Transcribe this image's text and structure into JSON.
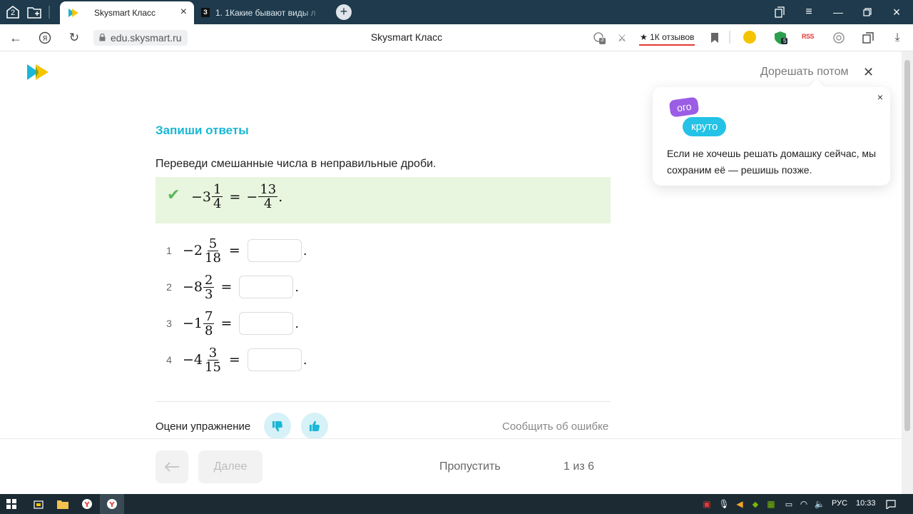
{
  "browser": {
    "tab_counter": "2",
    "active_tab_title": "Skysmart Класс",
    "inactive_tab_title": "1. 1Какие бывают виды л",
    "inactive_tab_favicon": "З",
    "url": "edu.skysmart.ru",
    "page_title": "Skysmart Класс",
    "reviews": "★ 1К отзывов",
    "ext_badge_count": "3",
    "shield_count": "5",
    "rss_label": "RSS"
  },
  "header": {
    "later_label": "Дорешать потом"
  },
  "tooltip": {
    "sticker_1": "ого",
    "sticker_2": "круто",
    "text": "Если не хочешь решать домашку сейчас, мы сохраним её — решишь позже."
  },
  "exercise": {
    "heading": "Запиши ответы",
    "instruction": "Переведи смешанные числа в неправильные дроби.",
    "example": {
      "lhs_sign": "−",
      "lhs_whole": "3",
      "lhs_num": "1",
      "lhs_den": "4",
      "equals": "=",
      "rhs_sign": "−",
      "rhs_num": "13",
      "rhs_den": "4",
      "end": "."
    },
    "tasks": [
      {
        "index": "1",
        "sign": "−",
        "whole": "2",
        "num": "5",
        "den": "18",
        "equals": "=",
        "answer": "",
        "end": "."
      },
      {
        "index": "2",
        "sign": "−",
        "whole": "8",
        "num": "2",
        "den": "3",
        "equals": "=",
        "answer": "",
        "end": "."
      },
      {
        "index": "3",
        "sign": "−",
        "whole": "1",
        "num": "7",
        "den": "8",
        "equals": "=",
        "answer": "",
        "end": "."
      },
      {
        "index": "4",
        "sign": "−",
        "whole": "4",
        "num": "3",
        "den": "15",
        "equals": "=",
        "answer": "",
        "end": "."
      }
    ],
    "rate_label": "Оцени упражнение",
    "report_label": "Сообщить об ошибке"
  },
  "footer": {
    "next_label": "Далее",
    "skip_label": "Пропустить",
    "counter": "1 из 6"
  },
  "taskbar": {
    "language": "РУС",
    "time": "10:33"
  },
  "colors": {
    "accent": "#1ab7d6",
    "example_bg": "#e8f5df",
    "check": "#5cb85c",
    "tab_strip": "#1e3a4c"
  }
}
